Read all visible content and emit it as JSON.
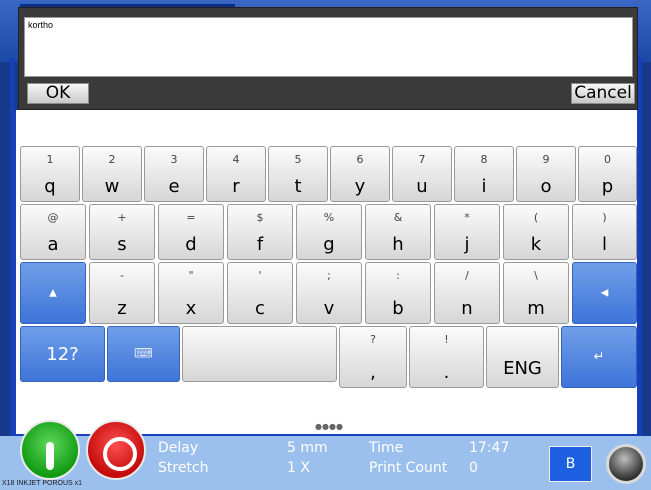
{
  "input": {
    "text": "kortho",
    "ok_label": "OK",
    "cancel_label": "Cancel"
  },
  "keyboard": {
    "row1": [
      {
        "sub": "1",
        "main": "q"
      },
      {
        "sub": "2",
        "main": "w"
      },
      {
        "sub": "3",
        "main": "e"
      },
      {
        "sub": "4",
        "main": "r"
      },
      {
        "sub": "5",
        "main": "t"
      },
      {
        "sub": "6",
        "main": "y"
      },
      {
        "sub": "7",
        "main": "u"
      },
      {
        "sub": "8",
        "main": "i"
      },
      {
        "sub": "9",
        "main": "o"
      },
      {
        "sub": "0",
        "main": "p"
      }
    ],
    "row2": [
      {
        "sub": "@",
        "main": "a"
      },
      {
        "sub": "+",
        "main": "s"
      },
      {
        "sub": "=",
        "main": "d"
      },
      {
        "sub": "$",
        "main": "f"
      },
      {
        "sub": "%",
        "main": "g"
      },
      {
        "sub": "&",
        "main": "h"
      },
      {
        "sub": "*",
        "main": "j"
      },
      {
        "sub": "(",
        "main": "k"
      },
      {
        "sub": ")",
        "main": "l"
      }
    ],
    "row3": [
      {
        "sub": "-",
        "main": "z"
      },
      {
        "sub": "\"",
        "main": "x"
      },
      {
        "sub": "'",
        "main": "c"
      },
      {
        "sub": ";",
        "main": "v"
      },
      {
        "sub": ":",
        "main": "b"
      },
      {
        "sub": "/",
        "main": "n"
      },
      {
        "sub": "\\",
        "main": "m"
      }
    ],
    "row4": {
      "numbers_label": "12?",
      "comma": {
        "sub": "?",
        "main": ","
      },
      "period": {
        "sub": "!",
        "main": "."
      },
      "language_label": "ENG"
    },
    "page_dots": "●●●●"
  },
  "status": {
    "delay_label": "Delay",
    "delay_value": "5 mm",
    "stretch_label": "Stretch",
    "stretch_value": "1 X",
    "time_label": "Time",
    "time_value": "17:47",
    "print_count_label": "Print Count",
    "print_count_value": "0",
    "mode_label": "B",
    "product_label": "X18 INKJET POROUS x1"
  }
}
